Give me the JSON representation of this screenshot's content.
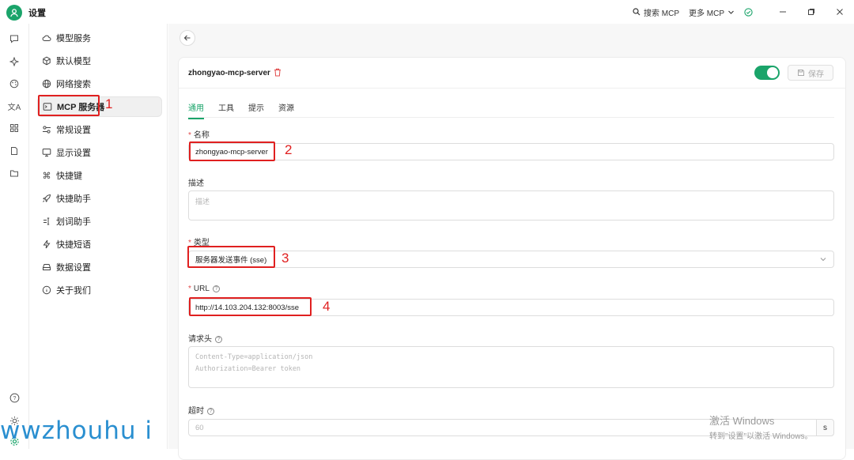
{
  "app": {
    "title": "设置"
  },
  "titlebar": {
    "search_mcp": "搜索 MCP",
    "more_mcp": "更多 MCP"
  },
  "sidebar": {
    "items": [
      {
        "label": "模型服务",
        "icon": "cloud-icon"
      },
      {
        "label": "默认模型",
        "icon": "cube-icon"
      },
      {
        "label": "网络搜索",
        "icon": "globe-icon"
      },
      {
        "label": "MCP 服务器",
        "icon": "terminal-icon",
        "active": true
      },
      {
        "label": "常规设置",
        "icon": "sliders-icon"
      },
      {
        "label": "显示设置",
        "icon": "monitor-icon"
      },
      {
        "label": "快捷键",
        "icon": "command-icon"
      },
      {
        "label": "快捷助手",
        "icon": "rocket-icon"
      },
      {
        "label": "划词助手",
        "icon": "select-text-icon"
      },
      {
        "label": "快捷短语",
        "icon": "zap-icon"
      },
      {
        "label": "数据设置",
        "icon": "hard-drive-icon"
      },
      {
        "label": "关于我们",
        "icon": "info-icon"
      }
    ]
  },
  "server": {
    "name": "zhongyao-mcp-server",
    "save_label": "保存",
    "enabled": true,
    "tabs": [
      {
        "label": "通用",
        "active": true
      },
      {
        "label": "工具"
      },
      {
        "label": "提示"
      },
      {
        "label": "资源"
      }
    ]
  },
  "form": {
    "name_label": "名称",
    "name_value": "zhongyao-mcp-server",
    "desc_label": "描述",
    "desc_placeholder": "描述",
    "type_label": "类型",
    "type_value": "服务器发送事件 (sse)",
    "url_label": "URL",
    "url_value": "http://14.103.204.132:8003/sse",
    "headers_label": "请求头",
    "headers_placeholder_1": "Content-Type=application/json",
    "headers_placeholder_2": "Authorization=Bearer token",
    "timeout_label": "超时",
    "timeout_placeholder": "60",
    "timeout_unit": "s"
  },
  "annotations": [
    "1",
    "2",
    "3",
    "4"
  ],
  "watermark": "wwzhouhu i",
  "activation": {
    "line1": "激活 Windows",
    "line2": "转到\"设置\"以激活 Windows。"
  },
  "colors": {
    "accent": "#1aa46a",
    "annotation": "#e02020",
    "watermark": "#2a8fd0"
  }
}
